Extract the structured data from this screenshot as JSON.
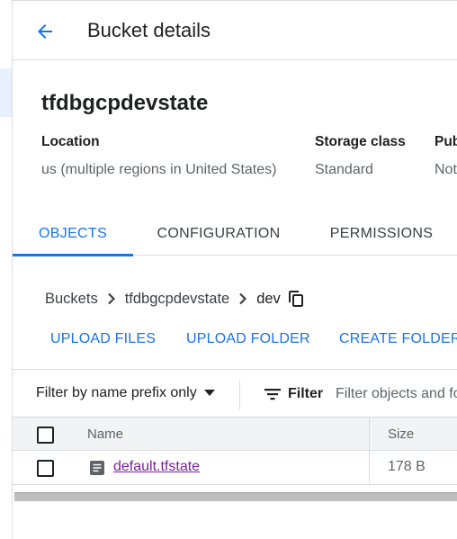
{
  "header": {
    "back_icon": "arrow-left-icon",
    "title": "Bucket details"
  },
  "bucket": {
    "name": "tfdbgcpdevstate",
    "location": {
      "label": "Location",
      "value": "us (multiple regions in United States)"
    },
    "storage_class": {
      "label": "Storage class",
      "value": "Standard"
    },
    "public_access": {
      "label": "Pub",
      "value": "Not"
    }
  },
  "tabs": [
    {
      "label": "OBJECTS",
      "active": true
    },
    {
      "label": "CONFIGURATION",
      "active": false
    },
    {
      "label": "PERMISSIONS",
      "active": false
    }
  ],
  "breadcrumb": {
    "items": [
      "Buckets",
      "tfdbgcpdevstate",
      "dev"
    ],
    "copy_icon": "copy-icon"
  },
  "actions": {
    "upload_files": "UPLOAD FILES",
    "upload_folder": "UPLOAD FOLDER",
    "create_folder": "CREATE FOLDER"
  },
  "filter": {
    "prefix_label": "Filter by name prefix only",
    "filter_label": "Filter",
    "placeholder": "Filter objects and folders"
  },
  "table": {
    "columns": {
      "name": "Name",
      "size": "Size"
    },
    "rows": [
      {
        "name": "default.tfstate",
        "size": "178 B",
        "icon": "file-icon"
      }
    ]
  },
  "colors": {
    "accent": "#1a73e8",
    "link_visited": "#7b1fa2",
    "text_muted": "#5f6368"
  }
}
